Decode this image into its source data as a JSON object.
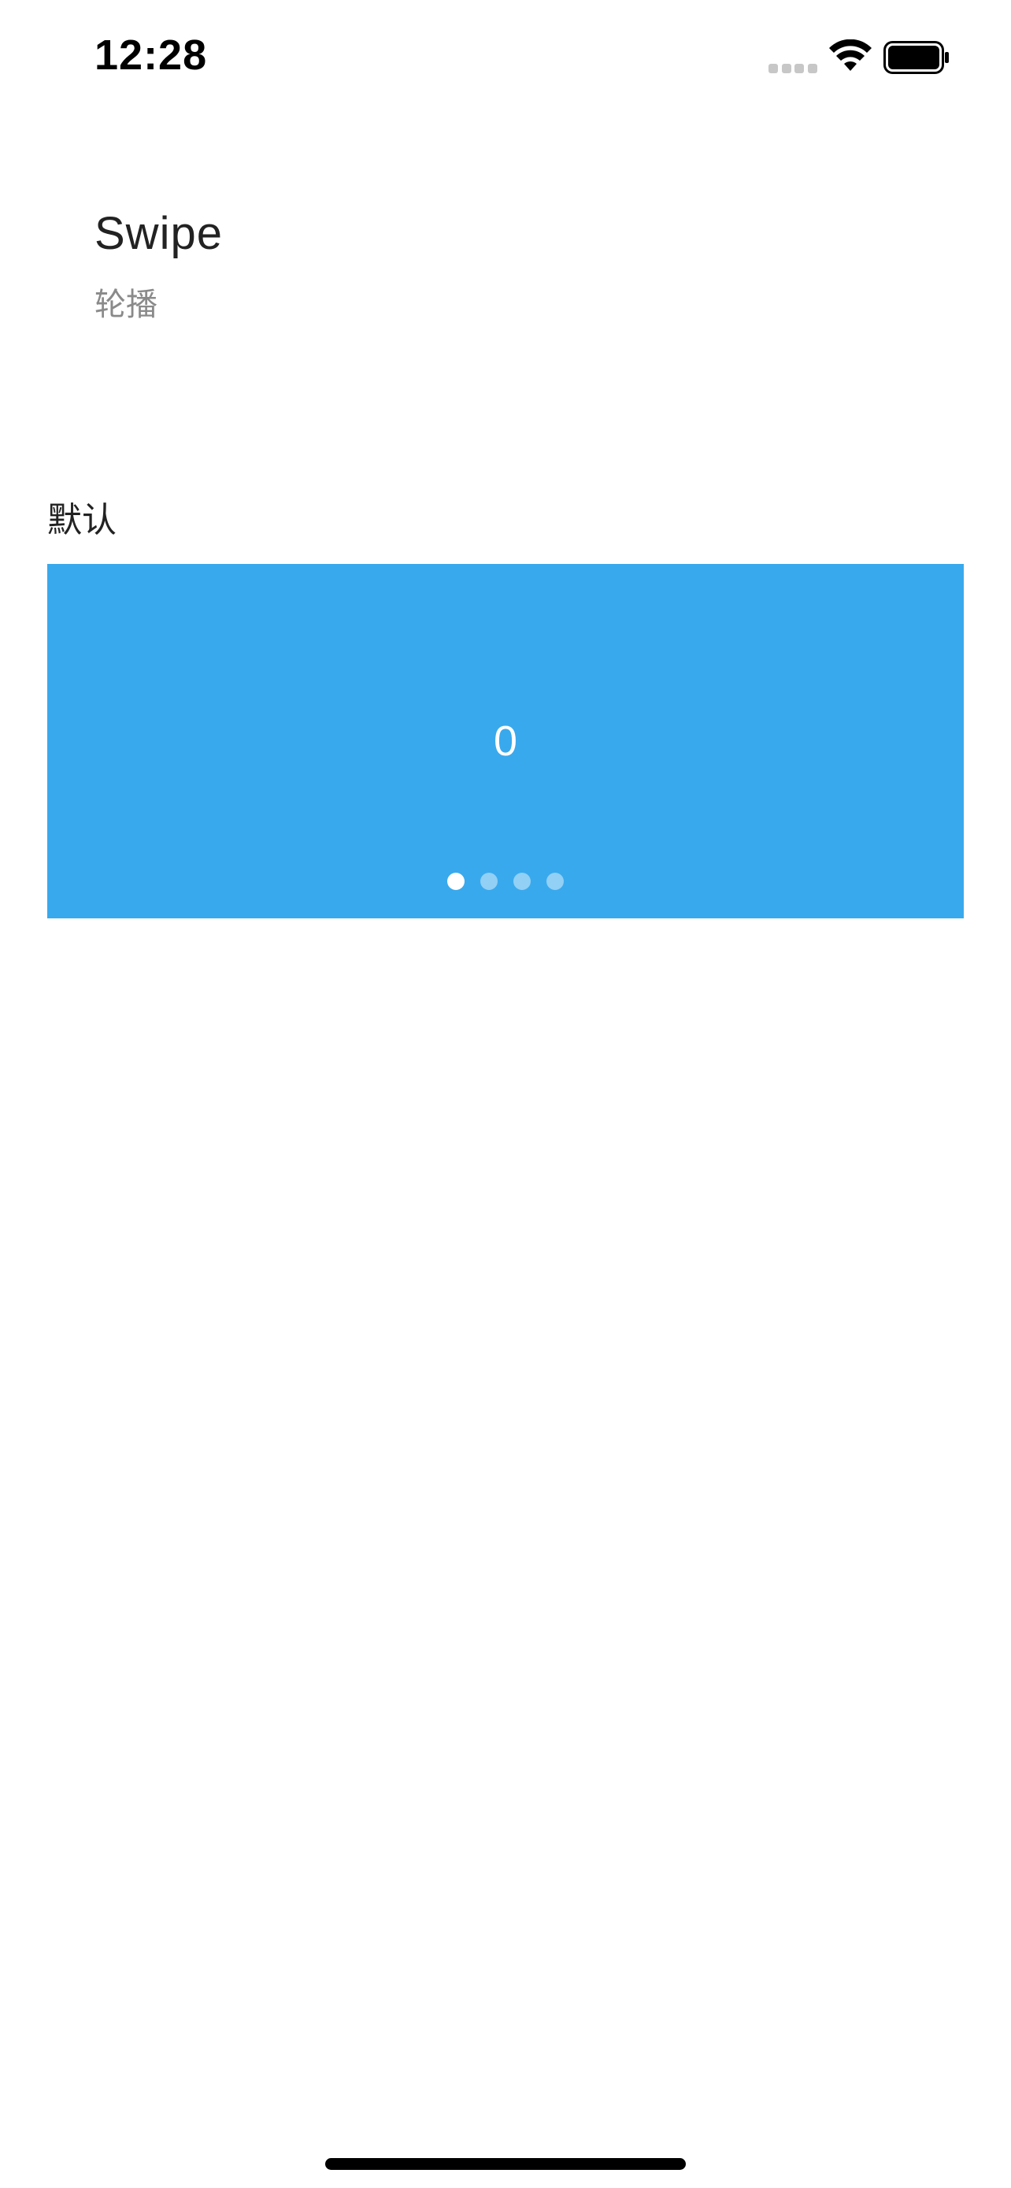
{
  "status_bar": {
    "time": "12:28",
    "icons": [
      "cellular-signal-icon",
      "wifi-icon",
      "battery-icon"
    ]
  },
  "header": {
    "title": "Swipe",
    "subtitle": "轮播"
  },
  "section": {
    "label": "默认"
  },
  "swipe": {
    "current_slide_text": "0",
    "slide_count": 4,
    "active_index": 0,
    "background_color": "#39a9ed"
  }
}
